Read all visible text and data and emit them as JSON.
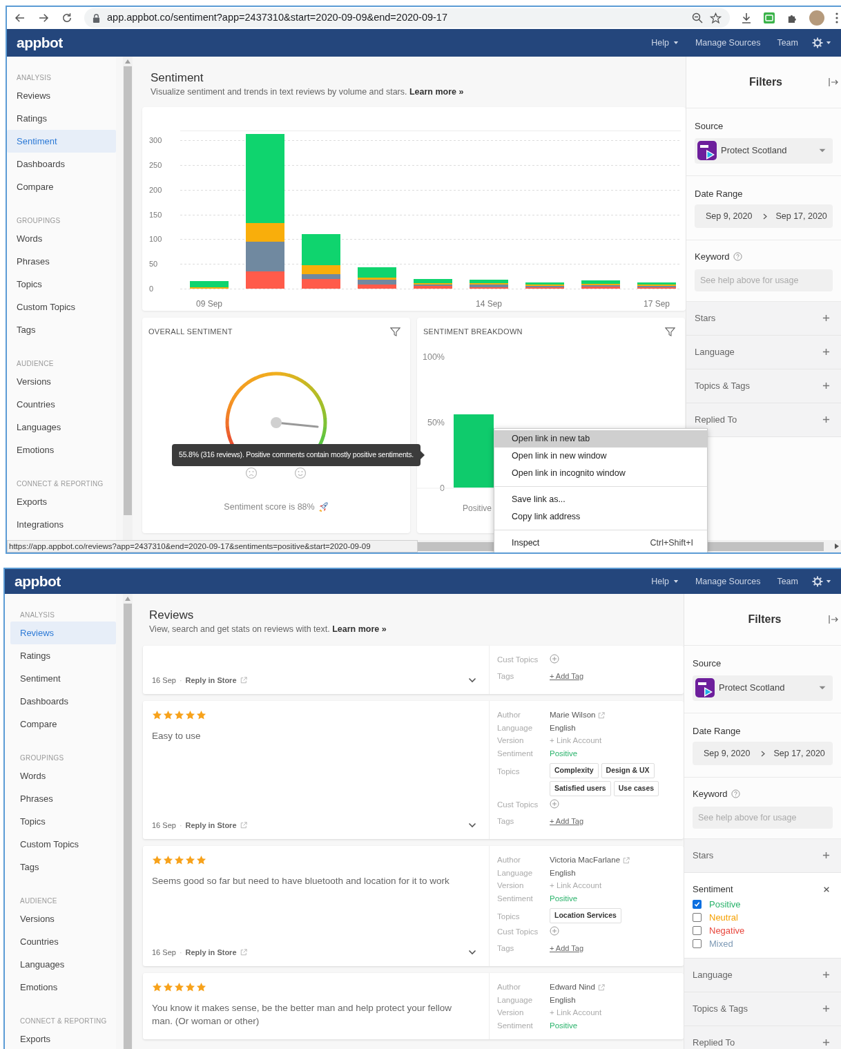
{
  "browser": {
    "url": "app.appbot.co/sentiment?app=2437310&start=2020-09-09&end=2020-09-17",
    "status_url": "https://app.appbot.co/reviews?app=2437310&end=2020-09-17&sentiments=positive&start=2020-09-09"
  },
  "sentiment_page": {
    "navbar": {
      "logo": "appbot",
      "links": [
        {
          "label": "Help",
          "dropdown": true
        },
        {
          "label": "Manage Sources",
          "dropdown": false
        },
        {
          "label": "Team",
          "dropdown": false
        }
      ]
    },
    "sidebar": [
      {
        "heading": "ANALYSIS",
        "items": [
          {
            "label": "Reviews",
            "selected": false
          },
          {
            "label": "Ratings",
            "selected": false
          },
          {
            "label": "Sentiment",
            "selected": true
          },
          {
            "label": "Dashboards",
            "selected": false
          },
          {
            "label": "Compare",
            "selected": false
          }
        ]
      },
      {
        "heading": "GROUPINGS",
        "items": [
          {
            "label": "Words",
            "selected": false
          },
          {
            "label": "Phrases",
            "selected": false
          },
          {
            "label": "Topics",
            "selected": false
          },
          {
            "label": "Custom Topics",
            "selected": false
          },
          {
            "label": "Tags",
            "selected": false
          }
        ]
      },
      {
        "heading": "AUDIENCE",
        "items": [
          {
            "label": "Versions",
            "selected": false
          },
          {
            "label": "Countries",
            "selected": false
          },
          {
            "label": "Languages",
            "selected": false
          },
          {
            "label": "Emotions",
            "selected": false
          }
        ]
      },
      {
        "heading": "CONNECT & REPORTING",
        "items": [
          {
            "label": "Exports",
            "selected": false
          },
          {
            "label": "Integrations",
            "selected": false
          }
        ]
      }
    ],
    "header": {
      "title": "Sentiment",
      "subtitle": "Visualize sentiment and trends in text reviews by volume and stars.",
      "link": "Learn more »"
    },
    "timeline": {
      "chart_data": {
        "type": "bar",
        "stacked": true,
        "grid": true,
        "categories": [
          "09 Sep",
          null,
          null,
          null,
          null,
          "14 Sep",
          null,
          null,
          "17 Sep"
        ],
        "series": [
          {
            "color": "#ff5b4a",
            "values": [
              0,
              35,
              19,
              8,
              5,
              3,
              3,
              4,
              3
            ]
          },
          {
            "color": "#7089a0",
            "values": [
              0,
              60,
              11,
              10,
              3,
              5,
              3,
              3,
              3
            ]
          },
          {
            "color": "#f9ae0b",
            "values": [
              3,
              38,
              18,
              4,
              3,
              3,
              3,
              3,
              3
            ]
          },
          {
            "color": "#0fd46e",
            "values": [
              12,
              180,
              62,
              21,
              9,
              7,
              4,
              7,
              4
            ]
          }
        ],
        "ylim": [
          0,
          320
        ],
        "yticks": [
          0,
          50,
          100,
          150,
          200,
          250,
          300
        ]
      }
    },
    "overall_sentiment": {
      "title": "OVERALL SENTIMENT",
      "tooltip": "55.8% (316 reviews). Positive comments contain mostly positive sentiments.",
      "score": "Sentiment score is 88%"
    },
    "breakdown": {
      "title": "SENTIMENT BREAKDOWN",
      "chart_data": {
        "type": "bar",
        "categories": [
          "Positive"
        ],
        "values": [
          55.8
        ],
        "ylim": [
          0,
          100
        ],
        "yticks": [
          {
            "value": 0,
            "label": "0"
          },
          {
            "value": 50,
            "label": "50%"
          },
          {
            "value": 100,
            "label": "100%"
          }
        ]
      }
    },
    "filters": {
      "title": "Filters",
      "source_label": "Source",
      "source": "Protect Scotland",
      "date_label": "Date Range",
      "date_start": "Sep 9, 2020",
      "date_end": "Sep 17, 2020",
      "keyword_label": "Keyword",
      "keyword_placeholder": "See help above for usage",
      "sections": [
        {
          "label": "Stars",
          "expanded": false
        },
        {
          "label": "Language",
          "expanded": false
        },
        {
          "label": "Topics & Tags",
          "expanded": false
        },
        {
          "label": "Replied To",
          "expanded": false
        }
      ]
    }
  },
  "context_menu": [
    [
      {
        "label": "Open link in new tab",
        "selected": true
      },
      {
        "label": "Open link in new window",
        "selected": false
      },
      {
        "label": "Open link in incognito window",
        "selected": false
      }
    ],
    [
      {
        "label": "Save link as...",
        "selected": false
      },
      {
        "label": "Copy link address",
        "selected": false
      }
    ],
    [
      {
        "label": "Inspect",
        "shortcut": "Ctrl+Shift+I",
        "selected": false
      }
    ]
  ],
  "reviews_page": {
    "navbar": {
      "logo": "appbot",
      "links": [
        {
          "label": "Help",
          "dropdown": true
        },
        {
          "label": "Manage Sources",
          "dropdown": false
        },
        {
          "label": "Team",
          "dropdown": false
        }
      ]
    },
    "sidebar": [
      {
        "heading": "ANALYSIS",
        "items": [
          {
            "label": "Reviews",
            "selected": true
          },
          {
            "label": "Ratings",
            "selected": false
          },
          {
            "label": "Sentiment",
            "selected": false
          },
          {
            "label": "Dashboards",
            "selected": false
          },
          {
            "label": "Compare",
            "selected": false
          }
        ]
      },
      {
        "heading": "GROUPINGS",
        "items": [
          {
            "label": "Words",
            "selected": false
          },
          {
            "label": "Phrases",
            "selected": false
          },
          {
            "label": "Topics",
            "selected": false
          },
          {
            "label": "Custom Topics",
            "selected": false
          },
          {
            "label": "Tags",
            "selected": false
          }
        ]
      },
      {
        "heading": "AUDIENCE",
        "items": [
          {
            "label": "Versions",
            "selected": false
          },
          {
            "label": "Countries",
            "selected": false
          },
          {
            "label": "Languages",
            "selected": false
          },
          {
            "label": "Emotions",
            "selected": false
          }
        ]
      },
      {
        "heading": "CONNECT & REPORTING",
        "items": [
          {
            "label": "Exports",
            "selected": false
          }
        ]
      }
    ],
    "header": {
      "title": "Reviews",
      "subtitle": "View, search and get stats on reviews with text.",
      "link": "Learn more »"
    },
    "reviews": [
      {
        "meta": [
          {
            "kind": "plus",
            "label": "Cust Topics"
          },
          {
            "kind": "add_tag",
            "label": "Tags",
            "value": "+ Add Tag"
          }
        ],
        "date": "16 Sep",
        "separator": "·",
        "reply": "Reply in Store"
      },
      {
        "stars": 5,
        "text": "Easy to use",
        "meta": [
          {
            "kind": "text",
            "label": "Author",
            "value": "Marie Wilson",
            "external": true
          },
          {
            "kind": "text",
            "label": "Language",
            "value": "English",
            "external": false
          },
          {
            "kind": "muted",
            "label": "Version",
            "value": "+ Link Account"
          },
          {
            "kind": "sentiment",
            "label": "Sentiment",
            "value": "Positive"
          },
          {
            "kind": "chips",
            "label": "Topics",
            "chips": [
              "Complexity",
              "Design & UX",
              "Satisfied users",
              "Use cases"
            ]
          },
          {
            "kind": "plus",
            "label": "Cust Topics"
          },
          {
            "kind": "add_tag",
            "label": "Tags",
            "value": "+ Add Tag"
          }
        ],
        "date": "16 Sep",
        "separator": "·",
        "reply": "Reply in Store"
      },
      {
        "stars": 5,
        "text": "Seems good so far but need to have bluetooth and location for it to work",
        "meta": [
          {
            "kind": "text",
            "label": "Author",
            "value": "Victoria MacFarlane",
            "external": true
          },
          {
            "kind": "text",
            "label": "Language",
            "value": "English",
            "external": false
          },
          {
            "kind": "muted",
            "label": "Version",
            "value": "+ Link Account"
          },
          {
            "kind": "sentiment",
            "label": "Sentiment",
            "value": "Positive"
          },
          {
            "kind": "chips",
            "label": "Topics",
            "chips": [
              "Location Services"
            ]
          },
          {
            "kind": "plus",
            "label": "Cust Topics"
          },
          {
            "kind": "add_tag",
            "label": "Tags",
            "value": "+ Add Tag"
          }
        ],
        "date": "16 Sep",
        "separator": "·",
        "reply": "Reply in Store"
      },
      {
        "stars": 5,
        "text": "You know it makes sense, be the better man and help protect your fellow man. (Or woman or other)",
        "meta": [
          {
            "kind": "text",
            "label": "Author",
            "value": "Edward Nind",
            "external": true
          },
          {
            "kind": "text",
            "label": "Language",
            "value": "English",
            "external": false
          },
          {
            "kind": "muted",
            "label": "Version",
            "value": "+ Link Account"
          },
          {
            "kind": "sentiment",
            "label": "Sentiment",
            "value": "Positive"
          }
        ]
      }
    ],
    "filters": {
      "title": "Filters",
      "source_label": "Source",
      "source": "Protect Scotland",
      "date_label": "Date Range",
      "date_start": "Sep 9, 2020",
      "date_end": "Sep 17, 2020",
      "keyword_label": "Keyword",
      "keyword_placeholder": "See help above for usage",
      "sections": [
        {
          "label": "Stars",
          "expanded": false
        },
        {
          "label": "Sentiment",
          "expanded": true,
          "options": [
            {
              "label": "Positive",
              "checked": true,
              "color": "#2ab36b"
            },
            {
              "label": "Neutral",
              "checked": false,
              "color": "#f5a000"
            },
            {
              "label": "Negative",
              "checked": false,
              "color": "#e8463c"
            },
            {
              "label": "Mixed",
              "checked": false,
              "color": "#7e9ab5"
            }
          ]
        },
        {
          "label": "Language",
          "expanded": false
        },
        {
          "label": "Topics & Tags",
          "expanded": false
        },
        {
          "label": "Replied To",
          "expanded": false
        }
      ]
    }
  }
}
